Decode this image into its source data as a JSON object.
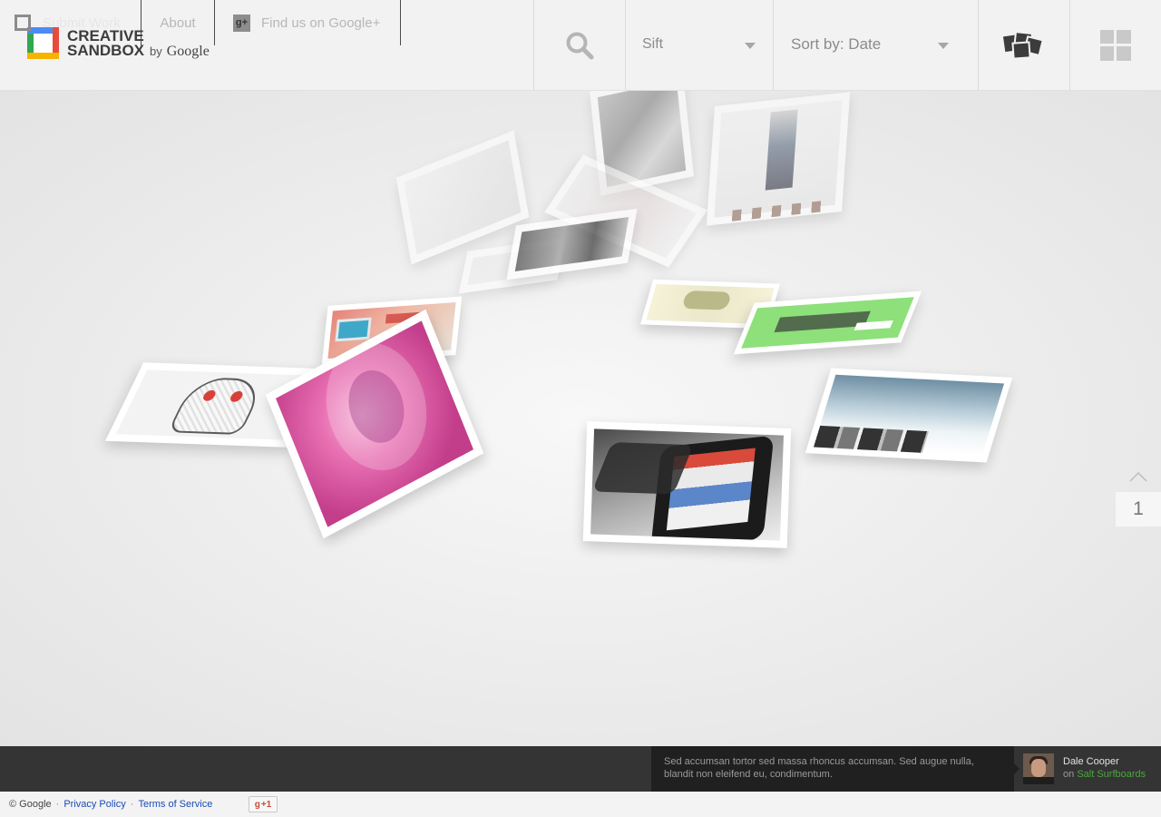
{
  "header": {
    "logo": {
      "line1": "CREATIVE",
      "line2": "SANDBOX",
      "by": "by",
      "brand": "Google"
    },
    "sift": {
      "label": "Sift"
    },
    "sort": {
      "label": "Sort by: Date"
    }
  },
  "pager": {
    "page": "1"
  },
  "footer_bar": {
    "submit_label": "Submit Work",
    "about_label": "About",
    "gplus_label": "Find us on Google+",
    "quote": "Sed accumsan tortor sed massa rhoncus accumsan. Sed augue nulla, blandit non eleifend eu, condimentum.",
    "author_name": "Dale Cooper",
    "author_on": "on",
    "author_company": "Salt Surfboards"
  },
  "legal": {
    "copyright": "© Google",
    "privacy": "Privacy Policy",
    "terms": "Terms of Service",
    "plusone": "+1"
  },
  "colors": {
    "logo_blue": "#4c8bf5",
    "logo_red": "#e84b3c",
    "logo_yellow": "#f6b400",
    "logo_green": "#2fa84f",
    "footer_bg": "#343434",
    "company_link": "#4aa83c"
  },
  "icons": {
    "search": "search-icon",
    "stack_view": "stack-view-icon",
    "grid_view": "grid-view-icon",
    "page_up": "chevron-up-icon"
  }
}
